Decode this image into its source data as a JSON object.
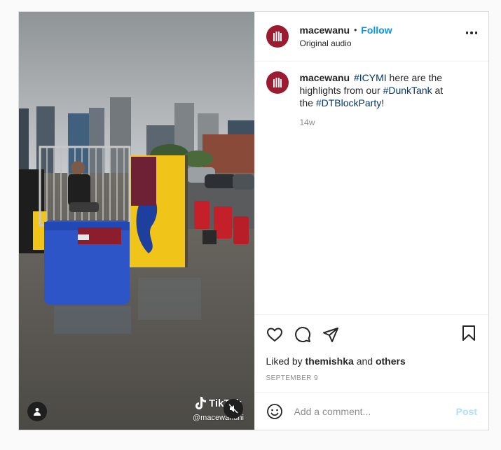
{
  "author": {
    "username": "macewanu",
    "follow_label": "Follow",
    "subtitle": "Original audio",
    "avatar_color": "#9b1b30"
  },
  "caption": {
    "username": "macewanu",
    "segments": [
      {
        "text": "#ICYMI",
        "tag": true
      },
      {
        "text": " here are the highlights from our ",
        "tag": false
      },
      {
        "text": "#DunkTank",
        "tag": true
      },
      {
        "text": " at the ",
        "tag": false
      },
      {
        "text": "#DTBlockParty",
        "tag": true
      },
      {
        "text": "!",
        "tag": false
      }
    ],
    "time_ago": "14w"
  },
  "media": {
    "watermark_text": "TikTok",
    "watermark_handle": "@macewanuni"
  },
  "engagement": {
    "liked_prefix": "Liked by",
    "liked_user": "themishka",
    "liked_and": "and",
    "liked_others": "others",
    "date": "SEPTEMBER 9"
  },
  "comment": {
    "placeholder": "Add a comment...",
    "post_label": "Post"
  },
  "colors": {
    "link": "#0095f6",
    "hashtag": "#00376b",
    "post_disabled": "#b2dffc",
    "brand": "#9b1b30"
  },
  "icons": [
    "heart-icon",
    "comment-icon",
    "share-icon",
    "bookmark-icon",
    "more-icon",
    "emoji-icon",
    "user-tag-icon",
    "muted-icon"
  ]
}
